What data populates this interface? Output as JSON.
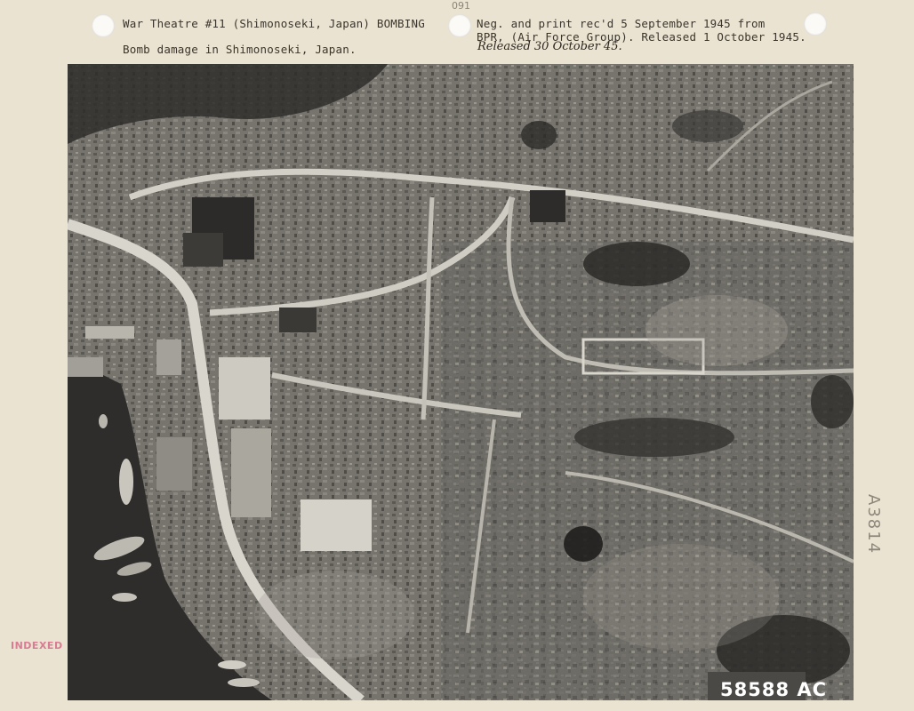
{
  "caption": {
    "line1": "War Theatre #11 (Shimonoseki, Japan) BOMBING",
    "line2": "Bomb damage in Shimonoseki, Japan.",
    "neg_line1": "Neg. and print rec'd 5 September 1945 from",
    "neg_line2": "BPR, (Air Force Group). Released 1 October 1945."
  },
  "annotations": {
    "handwritten_release": "Released 30 October 45.",
    "pencil_mark": "091",
    "side_code": "A3814",
    "index_stamp": "INDEXED"
  },
  "photo": {
    "negative_number": "58588 AC"
  }
}
